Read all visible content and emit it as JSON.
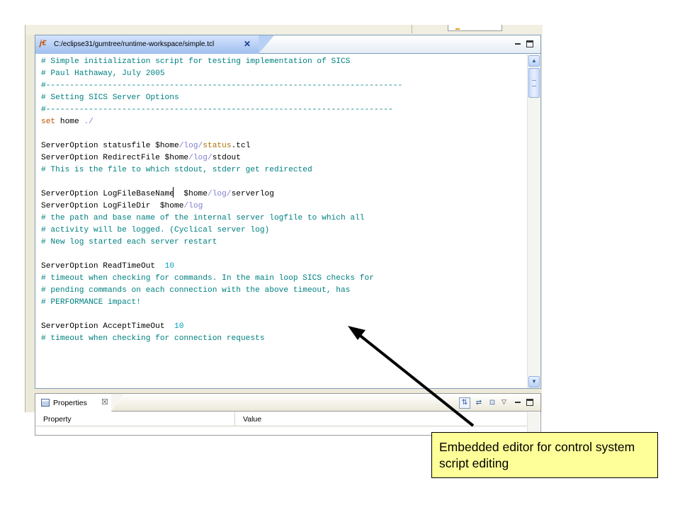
{
  "editor": {
    "tab_title": "C:/eclipse31/gumtree/runtime-workspace/simple.tcl",
    "tab_icon": "j€",
    "close_glyph": "✕"
  },
  "code_lines": [
    [
      {
        "t": "# Simple initialization script for testing implementation of SICS",
        "c": "cmt"
      }
    ],
    [
      {
        "t": "# Paul Hathaway, July 2005",
        "c": "cmt"
      }
    ],
    [
      {
        "t": "#---------------------------------------------------------------------------",
        "c": "cmt"
      }
    ],
    [
      {
        "t": "# Setting SICS Server Options",
        "c": "cmt"
      }
    ],
    [
      {
        "t": "#-------------------------------------------------------------------------",
        "c": "cmt"
      }
    ],
    [
      {
        "t": "set",
        "c": "kw"
      },
      {
        "t": " home ",
        "c": ""
      },
      {
        "t": "./",
        "c": "pth"
      }
    ],
    [],
    [
      {
        "t": "ServerOption statusfile $home",
        "c": ""
      },
      {
        "t": "/log/",
        "c": "pth"
      },
      {
        "t": "status",
        "c": "str"
      },
      {
        "t": ".tcl",
        "c": ""
      }
    ],
    [
      {
        "t": "ServerOption RedirectFile $home",
        "c": ""
      },
      {
        "t": "/log/",
        "c": "pth"
      },
      {
        "t": "stdout",
        "c": ""
      }
    ],
    [
      {
        "t": "# This is the file to which stdout, stderr get redirected",
        "c": "cmt"
      }
    ],
    [],
    [
      {
        "t": "ServerOption LogFileBaseName  $home",
        "c": ""
      },
      {
        "t": "/log/",
        "c": "pth"
      },
      {
        "t": "serverlog",
        "c": ""
      }
    ],
    [
      {
        "t": "ServerOption LogFileDir  $home",
        "c": ""
      },
      {
        "t": "/log",
        "c": "pth"
      }
    ],
    [
      {
        "t": "# the path and base name of the internal server logfile to which all",
        "c": "cmt"
      }
    ],
    [
      {
        "t": "# activity will be logged. (Cyclical server log)",
        "c": "cmt"
      }
    ],
    [
      {
        "t": "# New log started each server restart",
        "c": "cmt"
      }
    ],
    [],
    [
      {
        "t": "ServerOption ReadTimeOut  ",
        "c": ""
      },
      {
        "t": "10",
        "c": "num"
      }
    ],
    [
      {
        "t": "# timeout when checking for commands. In the main loop SICS checks for",
        "c": "cmt"
      }
    ],
    [
      {
        "t": "# pending commands on each connection with the above timeout, has",
        "c": "cmt"
      }
    ],
    [
      {
        "t": "# PERFORMANCE impact!",
        "c": "cmt"
      }
    ],
    [],
    [
      {
        "t": "ServerOption AcceptTimeOut  ",
        "c": ""
      },
      {
        "t": "10",
        "c": "num"
      }
    ],
    [
      {
        "t": "# timeout when checking for connection requests",
        "c": "cmt"
      }
    ]
  ],
  "properties": {
    "tab_label": "Properties",
    "close_glyph": "☒",
    "col_property": "Property",
    "col_value": "Value"
  },
  "callout": {
    "text": "Embedded editor for control system script editing"
  },
  "colors": {
    "comment": "#008080",
    "keyword": "#c05000",
    "number": "#00a0c0",
    "callout_bg": "#ffff99"
  }
}
